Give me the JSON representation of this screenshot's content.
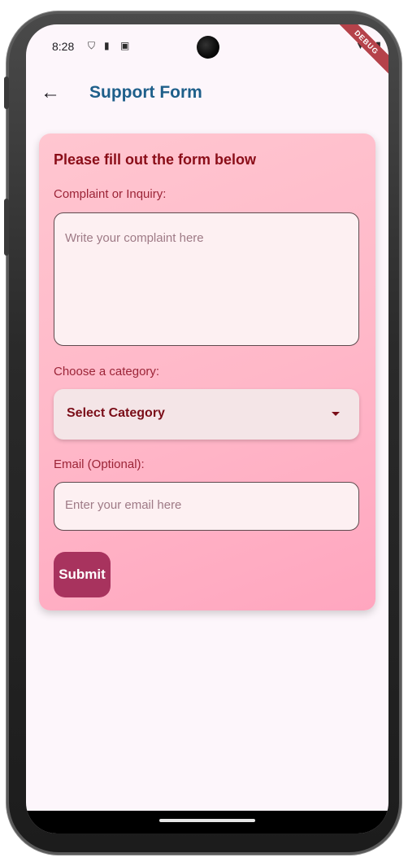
{
  "status_bar": {
    "time": "8:28",
    "debug_label": "DEBUG"
  },
  "app_bar": {
    "back_icon": "arrow-left-icon",
    "title": "Support Form"
  },
  "form": {
    "heading": "Please fill out the form below",
    "complaint": {
      "label": "Complaint or Inquiry:",
      "placeholder": "Write your complaint here"
    },
    "category": {
      "label": "Choose a category:",
      "selected": "Select Category"
    },
    "email": {
      "label": "Email (Optional):",
      "placeholder": "Enter your email here"
    },
    "submit_label": "Submit"
  },
  "colors": {
    "title": "#1e5f8a",
    "heading": "#8a0d18",
    "card_gradient_start": "#ffc6d0",
    "card_gradient_end": "#ffa6bf",
    "submit_bg": "#a8335e"
  }
}
